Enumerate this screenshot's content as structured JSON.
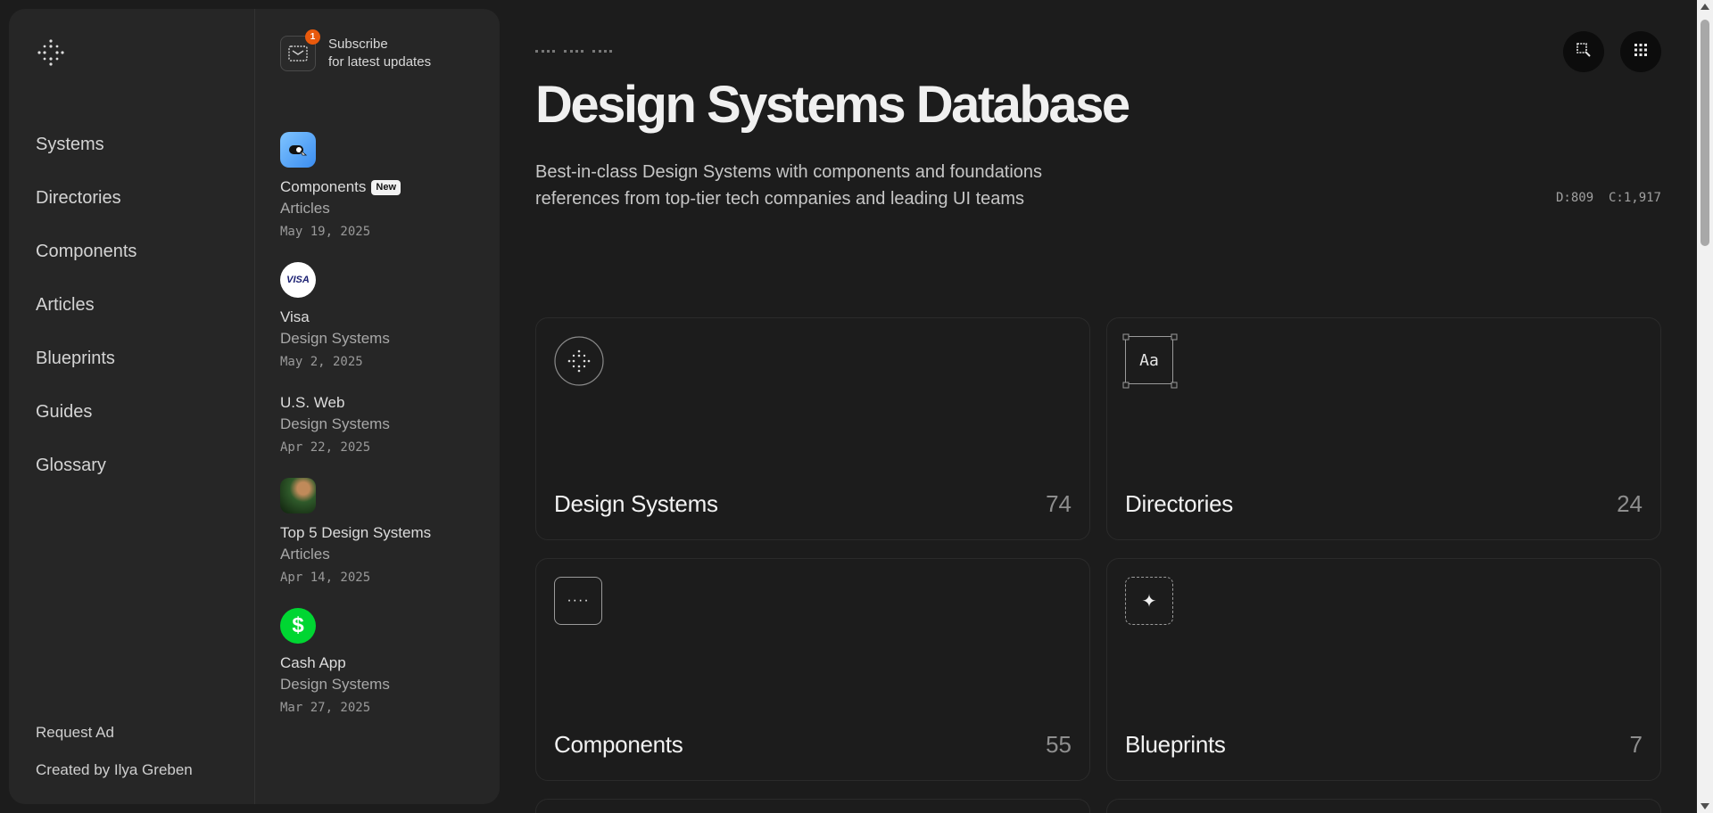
{
  "nav": {
    "items": [
      "Systems",
      "Directories",
      "Components",
      "Articles",
      "Blueprints",
      "Guides",
      "Glossary"
    ],
    "footer": {
      "request_ad": "Request Ad",
      "created_by": "Created by Ilya Greben"
    }
  },
  "subscribe": {
    "badge": "1",
    "line1": "Subscribe",
    "line2": "for latest updates"
  },
  "feed": [
    {
      "title": "Components",
      "badge": "New",
      "category": "Articles",
      "date": "May 19, 2025",
      "thumb": "components-thumb"
    },
    {
      "title": "Visa",
      "category": "Design Systems",
      "date": "May 2, 2025",
      "thumb": "visa-logo",
      "thumb_text": "VISA"
    },
    {
      "title": "U.S. Web",
      "category": "Design Systems",
      "date": "Apr 22, 2025",
      "thumb": "none"
    },
    {
      "title": "Top 5 Design Systems",
      "category": "Articles",
      "date": "Apr 14, 2025",
      "thumb": "article-photo-thumb"
    },
    {
      "title": "Cash App",
      "category": "Design Systems",
      "date": "Mar 27, 2025",
      "thumb": "cash-app-logo",
      "thumb_text": "$"
    }
  ],
  "main": {
    "title": "Design Systems Database",
    "subtitle_line1": "Best-in-class Design Systems with components and foundations",
    "subtitle_line2": "references from top-tier tech companies and leading UI teams",
    "counts": "D:809  C:1,917"
  },
  "cards": [
    {
      "label": "Design Systems",
      "count": "74",
      "icon": "sparkle-circle-icon"
    },
    {
      "label": "Directories",
      "count": "24",
      "icon": "typography-frame-icon",
      "icon_text": "Aa"
    },
    {
      "label": "Components",
      "count": "55",
      "icon": "dots-box-icon",
      "icon_text": "····"
    },
    {
      "label": "Blueprints",
      "count": "7",
      "icon": "sparkle-dashed-icon",
      "icon_text": "✦"
    }
  ],
  "colors": {
    "background": "#1c1c1c",
    "panel": "#262626",
    "badge_orange": "#e8590c",
    "cash_green": "#00d632",
    "visa_blue": "#1a1f71"
  }
}
